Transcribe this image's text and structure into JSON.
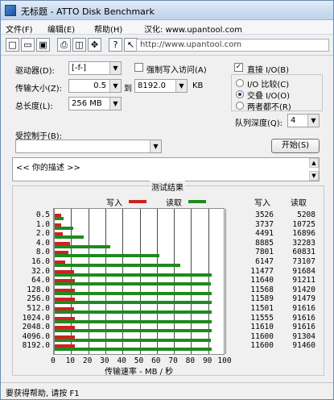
{
  "window": {
    "title": "无标题 - ATTO Disk Benchmark"
  },
  "menu": [
    "文件(F)",
    "编辑(E)",
    "帮助(H)",
    "汉化: www.upantool.com"
  ],
  "toolbar": {
    "url": "http://www.upantool.com"
  },
  "labels": {
    "drive": "驱动器(D):",
    "transfer_size": "传输大小(Z):",
    "total_length": "总长度(L):",
    "to": "到",
    "kb": "KB",
    "force_write": "强制写入访问(A)",
    "direct_io": "直接 I/O(B)",
    "io_compare": "I/O 比较(C)",
    "overlapped_io": "交叠 I/O(O)",
    "neither": "两者都不(R)",
    "queue_depth": "队列深度(Q):",
    "controlled_by": "受控制于(B):",
    "start": "开始(S)",
    "description": "<<  你的描述  >>"
  },
  "values": {
    "drive": "[-f-]",
    "transfer_from": "0.5",
    "transfer_to": "8192.0",
    "total_length": "256 MB",
    "queue_depth": "4",
    "controlled_by": ""
  },
  "colors": {
    "write": "#cc2222",
    "read": "#1e8a1e"
  },
  "results": {
    "title": "测试结果",
    "legend_write": "写入",
    "legend_read": "读取",
    "col_write": "写入",
    "col_read": "读取",
    "xlabel": "传输速率 - MB / 秒"
  },
  "chart_data": {
    "type": "bar",
    "title": "测试结果",
    "xlabel": "传输速率 - MB / 秒",
    "xlim": [
      0,
      100
    ],
    "x_ticks": [
      "0",
      "10",
      "20",
      "30",
      "40",
      "50",
      "60",
      "70",
      "80",
      "90",
      "100"
    ],
    "categories": [
      "0.5",
      "1.0",
      "2.0",
      "4.0",
      "8.0",
      "16.0",
      "32.0",
      "64.0",
      "128.0",
      "256.0",
      "512.0",
      "1024.0",
      "2048.0",
      "4096.0",
      "8192.0"
    ],
    "series": [
      {
        "name": "写入",
        "values": [
          3.526,
          3.737,
          4.491,
          8.885,
          7.801,
          6.147,
          11.477,
          11.64,
          11.568,
          11.589,
          11.501,
          11.555,
          11.61,
          11.6,
          11.6
        ]
      },
      {
        "name": "读取",
        "values": [
          5.208,
          10.725,
          16.896,
          32.283,
          60.831,
          73.107,
          91.684,
          91.211,
          91.42,
          91.479,
          91.616,
          91.616,
          91.616,
          91.304,
          91.46
        ]
      }
    ],
    "write_kb": [
      "3526",
      "3737",
      "4491",
      "8885",
      "7801",
      "6147",
      "11477",
      "11640",
      "11568",
      "11589",
      "11501",
      "11555",
      "11610",
      "11600",
      "11600"
    ],
    "read_kb": [
      "5208",
      "10725",
      "16896",
      "32283",
      "60831",
      "73107",
      "91684",
      "91211",
      "91420",
      "91479",
      "91616",
      "91616",
      "91616",
      "91304",
      "91460"
    ]
  },
  "status": "要获得帮助, 请按 F1"
}
